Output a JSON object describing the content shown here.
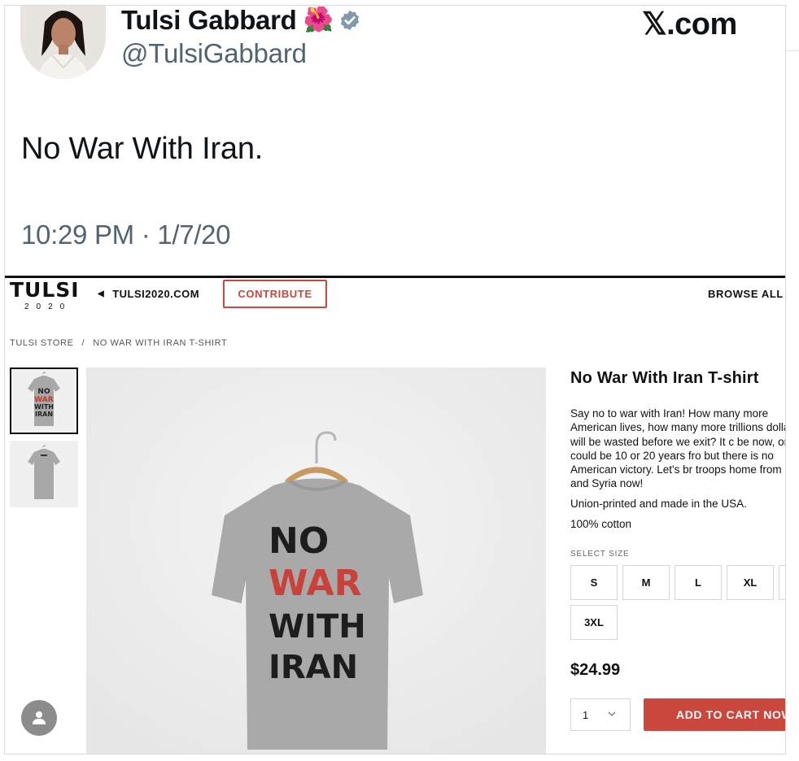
{
  "tweet": {
    "name": "Tulsi Gabbard",
    "name_emoji": "🌺",
    "handle": "@TulsiGabbard",
    "site": "𝕏.com",
    "text": "No War With Iran.",
    "timestamp": "10:29 PM · 1/7/20"
  },
  "store": {
    "logo_main": "TULSI",
    "logo_sub": "2020",
    "back_link": "TULSI2020.COM",
    "contribute": "CONTRIBUTE",
    "browse_all": "BROWSE ALL",
    "breadcrumb": [
      "TULSI STORE",
      "NO WAR WITH IRAN T-SHIRT"
    ],
    "breadcrumb_sep": "/",
    "product": {
      "title": "No War With Iran T-shirt",
      "description": "Say no to war with Iran! How many more American lives, how many more trillions dollars will be wasted before we exit? It c be now, or it could be 10 or 20 years fro but there is no American victory. Let's br troops home from Iraq and Syria now!",
      "made_in": "Union-printed and made in the USA.",
      "material": "100% cotton",
      "size_label": "SELECT SIZE",
      "sizes": [
        "S",
        "M",
        "L",
        "XL",
        "3XL"
      ],
      "price": "$24.99",
      "quantity": "1",
      "add_to_cart": "ADD TO CART NOW"
    },
    "shirt_print": [
      "NO",
      "WAR",
      "WITH",
      "IRAN"
    ]
  },
  "colors": {
    "accent_red": "#c9473d",
    "tweet_grey": "#536471",
    "verified_grey": "#829aab"
  },
  "icons": [
    "hibiscus-emoji",
    "verified-badge-icon",
    "back-arrow-icon",
    "chevron-down-icon",
    "user-icon"
  ]
}
